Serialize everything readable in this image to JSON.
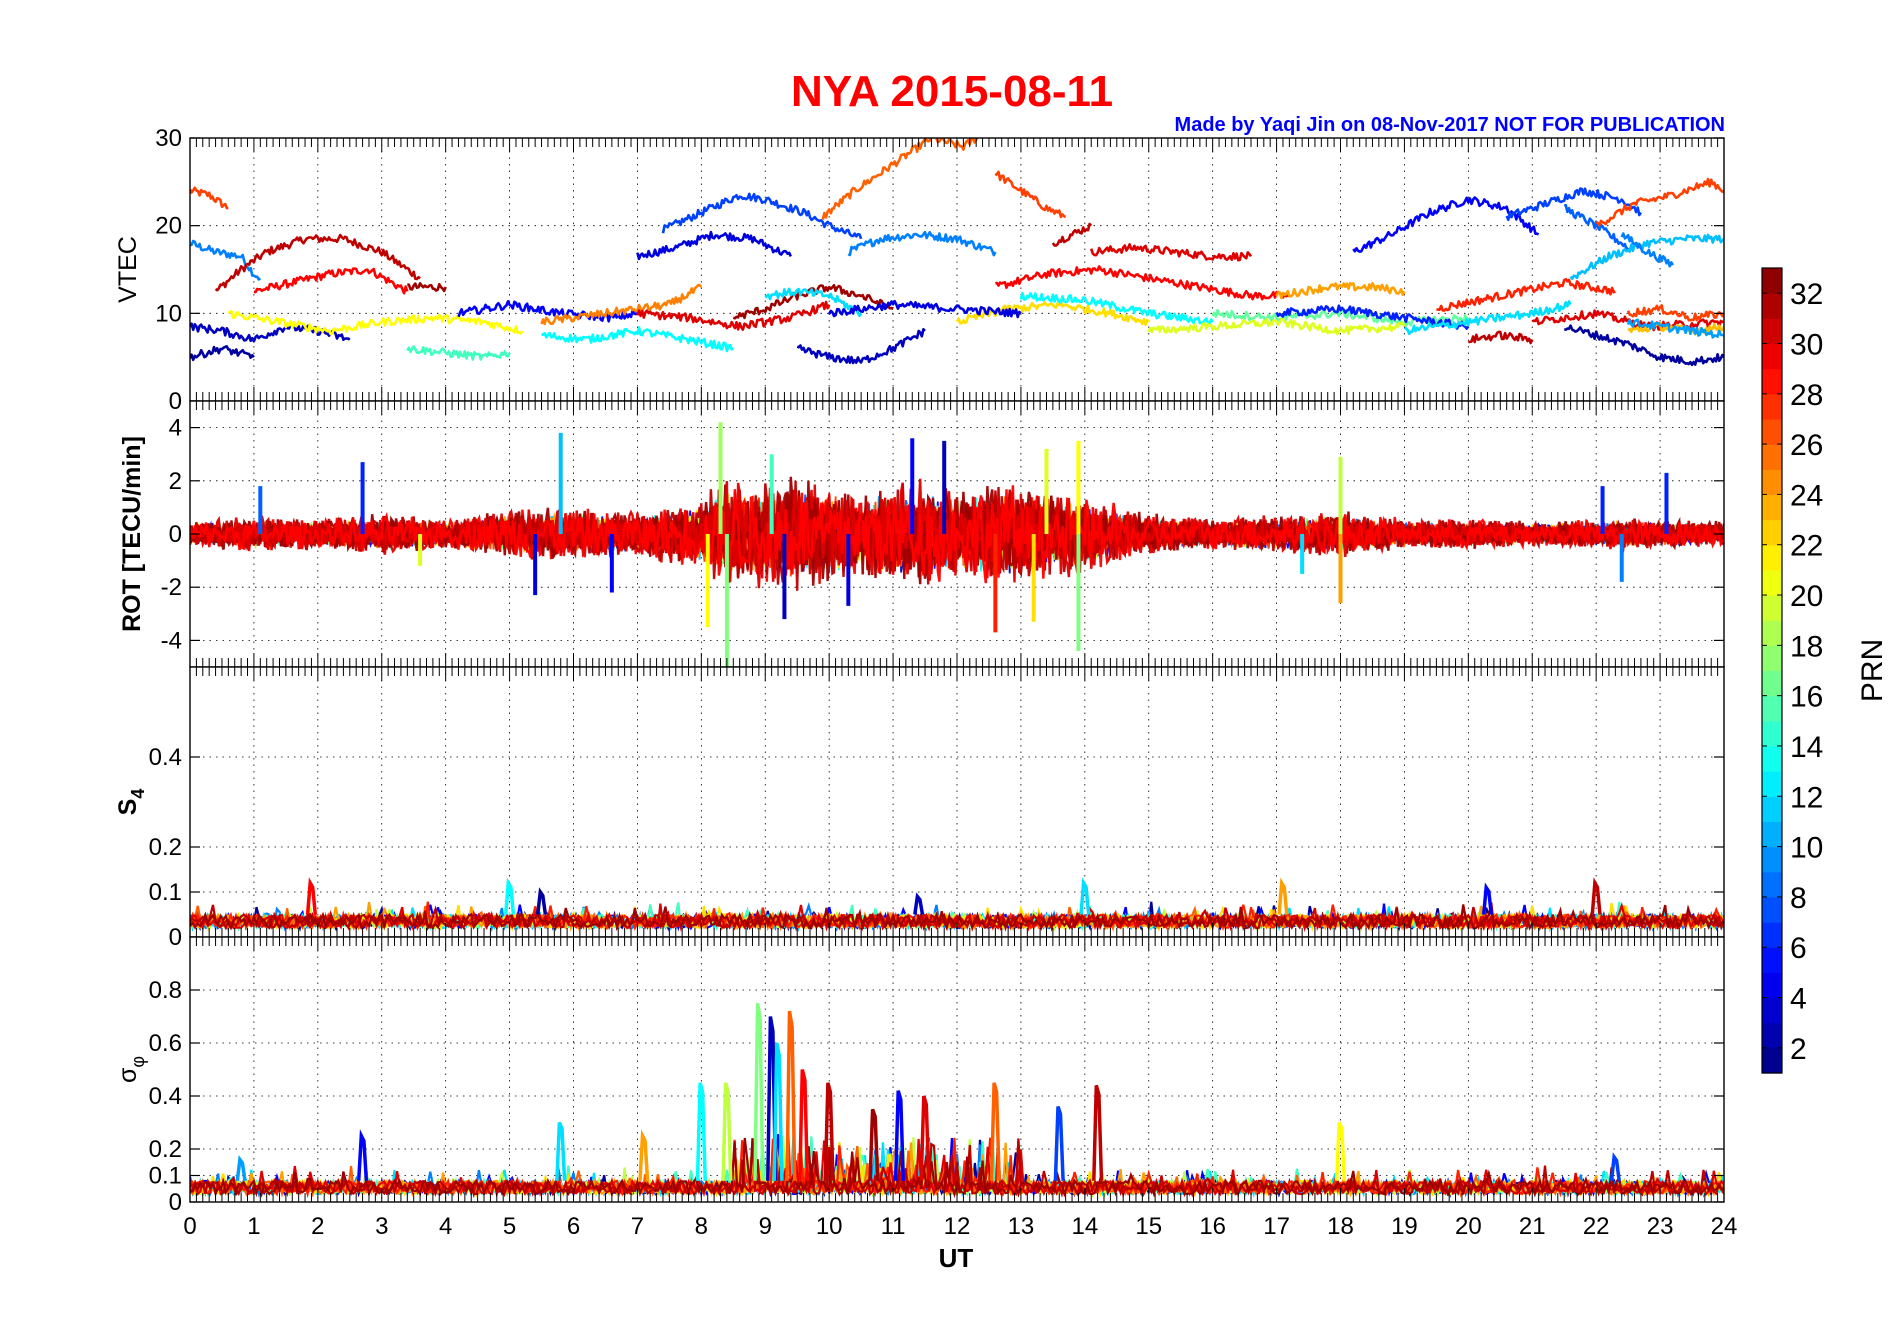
{
  "title": "NYA   2015-08-11",
  "credit": "Made by Yaqi Jin on 08-Nov-2017       NOT FOR PUBLICATION",
  "colors": {
    "title": "#ff0000",
    "credit": "#0000ff",
    "axis": "#000000",
    "grid": "#000000"
  },
  "chart_data": [
    {
      "type": "line",
      "panel": "vtec",
      "ylabel": "VTEC",
      "ylim": [
        0,
        30
      ],
      "yticks": [
        0,
        10,
        20,
        30
      ],
      "xlim": [
        0,
        24
      ],
      "grid": true,
      "series": [
        {
          "prn": 27,
          "x": [
            0,
            0.3,
            0.6
          ],
          "y": [
            24,
            23.5,
            22
          ]
        },
        {
          "prn": 9,
          "x": [
            0,
            0.4,
            0.8,
            1.0,
            1.1
          ],
          "y": [
            18,
            17,
            16.5,
            14.5,
            14
          ]
        },
        {
          "prn": 31,
          "x": [
            0.4,
            0.8,
            1.2,
            1.8,
            2.4,
            3.0,
            3.6
          ],
          "y": [
            12.5,
            15,
            17,
            18.5,
            18.5,
            17,
            14
          ]
        },
        {
          "prn": 29,
          "x": [
            1.0,
            1.6,
            2.2,
            2.8,
            3.4
          ],
          "y": [
            12.5,
            13.5,
            14.5,
            15,
            12.5
          ]
        },
        {
          "prn": 32,
          "x": [
            3.4,
            4.0
          ],
          "y": [
            13,
            13
          ]
        },
        {
          "prn": 7,
          "x": [
            7.4,
            8.0,
            8.6,
            9.0,
            9.6,
            10.0,
            10.5
          ],
          "y": [
            19.5,
            21.5,
            23.5,
            23,
            21.5,
            20,
            18.5
          ]
        },
        {
          "prn": 4,
          "x": [
            7.0,
            7.6,
            8.2,
            8.8,
            9.4
          ],
          "y": [
            16.5,
            17.5,
            19,
            18.5,
            16.5
          ]
        },
        {
          "prn": 26,
          "x": [
            9.9,
            10.4,
            11.0,
            11.6,
            12.1,
            12.5
          ],
          "y": [
            21,
            24,
            27,
            30,
            29,
            31
          ]
        },
        {
          "prn": 27,
          "x": [
            12.6,
            13.0,
            13.4,
            13.7
          ],
          "y": [
            26,
            24,
            22,
            21
          ]
        },
        {
          "prn": 9,
          "x": [
            10.3,
            10.8,
            11.4,
            12.0,
            12.6
          ],
          "y": [
            17,
            18.5,
            19,
            18.5,
            17
          ]
        },
        {
          "prn": 31,
          "x": [
            13.5,
            13.8,
            14.1
          ],
          "y": [
            18,
            19,
            20
          ]
        },
        {
          "prn": 30,
          "x": [
            14.1,
            14.8,
            15.4,
            16.0,
            16.6
          ],
          "y": [
            17,
            17.5,
            17,
            16.5,
            16.5
          ]
        },
        {
          "prn": 29,
          "x": [
            12.6,
            13.4,
            14.2,
            15.0,
            15.8,
            16.6,
            17.2
          ],
          "y": [
            13,
            14.5,
            15,
            14,
            13,
            12,
            12
          ]
        },
        {
          "prn": 5,
          "x": [
            18.2,
            18.8,
            19.4,
            20.0,
            20.6,
            21.1
          ],
          "y": [
            17,
            19,
            21.5,
            23,
            22,
            19
          ]
        },
        {
          "prn": 7,
          "x": [
            20.6,
            21.2,
            21.8,
            22.4,
            22.7
          ],
          "y": [
            21,
            22.5,
            24,
            23,
            21.5
          ]
        },
        {
          "prn": 8,
          "x": [
            21.5,
            22.0,
            22.5
          ],
          "y": [
            22,
            20,
            17.5
          ]
        },
        {
          "prn": 11,
          "x": [
            21.6,
            22.2,
            22.8,
            23.4,
            24.0
          ],
          "y": [
            14,
            16.5,
            18,
            18.5,
            18.5
          ]
        },
        {
          "prn": 27,
          "x": [
            22.0,
            22.6,
            23.2,
            23.8,
            24.0
          ],
          "y": [
            20,
            22.5,
            23.5,
            25,
            24
          ]
        },
        {
          "prn": 9,
          "x": [
            22.4,
            22.8,
            23.2
          ],
          "y": [
            19,
            17,
            15.5
          ]
        },
        {
          "prn": 28,
          "x": [
            19.5,
            20.5,
            21.5,
            22.3
          ],
          "y": [
            10.5,
            12,
            13.5,
            12.5
          ]
        },
        {
          "prn": 24,
          "x": [
            17.0,
            17.8,
            18.5,
            19.0
          ],
          "y": [
            12,
            13,
            13,
            12.5
          ]
        },
        {
          "prn": 3,
          "x": [
            0,
            0.5,
            1.0,
            1.5,
            2.0,
            2.5
          ],
          "y": [
            8.5,
            8,
            7,
            8.5,
            8,
            7
          ]
        },
        {
          "prn": 21,
          "x": [
            0.6,
            1.4,
            2.2,
            3.0,
            3.8,
            4.6,
            5.2
          ],
          "y": [
            10,
            9,
            8,
            9,
            9.5,
            9,
            8
          ]
        },
        {
          "prn": 15,
          "x": [
            3.4,
            4.0,
            4.6,
            5.0
          ],
          "y": [
            6,
            5.5,
            5,
            5.5
          ]
        },
        {
          "prn": 2,
          "x": [
            0,
            0.5,
            1.0
          ],
          "y": [
            5,
            6,
            5
          ]
        },
        {
          "prn": 5,
          "x": [
            4.2,
            5.0,
            5.8,
            6.6,
            7.0
          ],
          "y": [
            10,
            11,
            10,
            9.5,
            10
          ]
        },
        {
          "prn": 13,
          "x": [
            5.5,
            6.2,
            7.0,
            7.8,
            8.5
          ],
          "y": [
            7.5,
            7,
            8,
            7,
            6
          ]
        },
        {
          "prn": 25,
          "x": [
            5.5,
            6.5,
            7.5,
            8.0
          ],
          "y": [
            9,
            10,
            11,
            13
          ]
        },
        {
          "prn": 3,
          "x": [
            9.5,
            10.0,
            10.5,
            11.0,
            11.5
          ],
          "y": [
            6,
            5,
            4.5,
            6,
            8
          ]
        },
        {
          "prn": 32,
          "x": [
            8.5,
            9.0,
            9.5,
            10.0,
            10.5,
            11.0
          ],
          "y": [
            9.5,
            10.5,
            12,
            13,
            12,
            10.5
          ]
        },
        {
          "prn": 30,
          "x": [
            7.0,
            7.8,
            8.6,
            9.4,
            10.0
          ],
          "y": [
            10,
            9.5,
            8.5,
            9.5,
            11
          ]
        },
        {
          "prn": 22,
          "x": [
            12.0,
            12.8,
            13.6,
            14.4,
            15.0
          ],
          "y": [
            9,
            10.5,
            11,
            10,
            9
          ]
        },
        {
          "prn": 12,
          "x": [
            9.0,
            9.5,
            10.0,
            10.5
          ],
          "y": [
            12,
            12.5,
            12,
            10
          ]
        },
        {
          "prn": 4,
          "x": [
            10.0,
            11.0,
            12.0,
            13.0
          ],
          "y": [
            10,
            11,
            10.5,
            10
          ]
        },
        {
          "prn": 13,
          "x": [
            13.0,
            14.0,
            15.0,
            16.0
          ],
          "y": [
            12,
            11.5,
            10,
            9
          ]
        },
        {
          "prn": 16,
          "x": [
            16.0,
            17.0,
            18.0,
            19.0,
            20.0
          ],
          "y": [
            10,
            9.5,
            10,
            9,
            9.5
          ]
        },
        {
          "prn": 20,
          "x": [
            15.0,
            16.0,
            17.0,
            18.0,
            19.0
          ],
          "y": [
            8,
            8.5,
            9,
            8,
            8.5
          ]
        },
        {
          "prn": 6,
          "x": [
            17.0,
            18.0,
            19.0,
            20.0
          ],
          "y": [
            10,
            10.5,
            9.5,
            8.5
          ]
        },
        {
          "prn": 12,
          "x": [
            19.0,
            20.0,
            21.0,
            21.6
          ],
          "y": [
            8,
            9,
            10,
            11
          ]
        },
        {
          "prn": 31,
          "x": [
            20.0,
            20.5,
            21.0
          ],
          "y": [
            7,
            7.5,
            7
          ]
        },
        {
          "prn": 2,
          "x": [
            21.5,
            22.0,
            22.5,
            23.0,
            23.5,
            24.0
          ],
          "y": [
            8.5,
            7.5,
            6.5,
            5,
            4.5,
            5
          ]
        },
        {
          "prn": 30,
          "x": [
            21.0,
            22.0,
            22.8,
            24.0
          ],
          "y": [
            9,
            10,
            8.5,
            9
          ]
        },
        {
          "prn": 23,
          "x": [
            22.5,
            23.0,
            23.5,
            24.0
          ],
          "y": [
            8,
            8.5,
            8,
            8.5
          ]
        },
        {
          "prn": 10,
          "x": [
            22.5,
            23.0,
            23.5,
            24.0
          ],
          "y": [
            9,
            8.5,
            8,
            7.5
          ]
        },
        {
          "prn": 27,
          "x": [
            22.5,
            23.0,
            23.5,
            24.0
          ],
          "y": [
            10,
            10.5,
            9.5,
            10
          ]
        }
      ]
    },
    {
      "type": "line",
      "panel": "rot",
      "ylabel": "ROT [TECU/min]",
      "ylim": [
        -5,
        5
      ],
      "yticks": [
        -4,
        -2,
        0,
        2,
        4
      ],
      "xlim": [
        0,
        24
      ],
      "grid": true,
      "envelope": [
        [
          0,
          0.5
        ],
        [
          1,
          0.7
        ],
        [
          2,
          0.6
        ],
        [
          3,
          0.8
        ],
        [
          4,
          0.6
        ],
        [
          5,
          1.0
        ],
        [
          6,
          1.1
        ],
        [
          7,
          0.9
        ],
        [
          8,
          1.4
        ],
        [
          8.5,
          2.4
        ],
        [
          9,
          2.1
        ],
        [
          9.5,
          2.3
        ],
        [
          10,
          2.0
        ],
        [
          10.5,
          1.8
        ],
        [
          11,
          2.0
        ],
        [
          11.5,
          2.2
        ],
        [
          12,
          1.7
        ],
        [
          12.5,
          2.2
        ],
        [
          13,
          2.0
        ],
        [
          13.5,
          1.8
        ],
        [
          14,
          1.5
        ],
        [
          15,
          0.8
        ],
        [
          16,
          0.6
        ],
        [
          17,
          0.8
        ],
        [
          18,
          0.9
        ],
        [
          19,
          0.6
        ],
        [
          20,
          0.6
        ],
        [
          21,
          0.5
        ],
        [
          22,
          0.6
        ],
        [
          23,
          0.6
        ],
        [
          24,
          0.5
        ]
      ],
      "spikes": [
        {
          "x": 1.1,
          "y": 1.8,
          "prn": 8
        },
        {
          "x": 2.7,
          "y": 2.7,
          "prn": 6
        },
        {
          "x": 3.6,
          "y": -1.2,
          "prn": 20
        },
        {
          "x": 5.4,
          "y": -2.3,
          "prn": 4
        },
        {
          "x": 5.8,
          "y": 3.8,
          "prn": 11
        },
        {
          "x": 6.6,
          "y": -2.2,
          "prn": 5
        },
        {
          "x": 8.3,
          "y": 4.2,
          "prn": 18
        },
        {
          "x": 8.4,
          "y": -5.0,
          "prn": 17
        },
        {
          "x": 8.1,
          "y": -3.5,
          "prn": 21
        },
        {
          "x": 9.1,
          "y": 3.0,
          "prn": 15
        },
        {
          "x": 9.3,
          "y": -3.2,
          "prn": 3
        },
        {
          "x": 10.3,
          "y": -2.7,
          "prn": 4
        },
        {
          "x": 11.3,
          "y": 3.6,
          "prn": 5
        },
        {
          "x": 11.8,
          "y": 3.5,
          "prn": 3
        },
        {
          "x": 12.6,
          "y": -3.7,
          "prn": 28
        },
        {
          "x": 13.2,
          "y": -3.3,
          "prn": 22
        },
        {
          "x": 13.4,
          "y": 3.2,
          "prn": 20
        },
        {
          "x": 13.9,
          "y": 3.5,
          "prn": 21
        },
        {
          "x": 13.9,
          "y": -4.4,
          "prn": 17
        },
        {
          "x": 17.4,
          "y": -1.5,
          "prn": 12
        },
        {
          "x": 18.0,
          "y": 2.9,
          "prn": 19
        },
        {
          "x": 18.0,
          "y": -2.6,
          "prn": 24
        },
        {
          "x": 22.1,
          "y": 1.8,
          "prn": 6
        },
        {
          "x": 22.4,
          "y": -1.8,
          "prn": 9
        },
        {
          "x": 23.1,
          "y": 2.3,
          "prn": 6
        }
      ]
    },
    {
      "type": "line",
      "panel": "s4",
      "ylabel": "S",
      "ylabel_sub": "4",
      "ylim": [
        0,
        0.6
      ],
      "yticks": [
        0,
        0.1,
        0.2,
        0.4
      ],
      "xlim": [
        0,
        24
      ],
      "grid": true,
      "baseline": [
        0.02,
        0.05
      ],
      "spikes": [
        {
          "x": 1.9,
          "y": 0.12,
          "prn": 29
        },
        {
          "x": 5.0,
          "y": 0.12,
          "prn": 13
        },
        {
          "x": 5.5,
          "y": 0.1,
          "prn": 2
        },
        {
          "x": 11.4,
          "y": 0.09,
          "prn": 3
        },
        {
          "x": 14.0,
          "y": 0.12,
          "prn": 12
        },
        {
          "x": 17.1,
          "y": 0.12,
          "prn": 24
        },
        {
          "x": 20.3,
          "y": 0.11,
          "prn": 5
        },
        {
          "x": 22.0,
          "y": 0.12,
          "prn": 31
        }
      ]
    },
    {
      "type": "line",
      "panel": "sigma_phi",
      "ylabel": "σ",
      "ylabel_sub": "φ",
      "ylim": [
        0,
        1.0
      ],
      "yticks": [
        0,
        0.1,
        0.2,
        0.4,
        0.6,
        0.8
      ],
      "xlim": [
        0,
        24
      ],
      "xticks": [
        0,
        1,
        2,
        3,
        4,
        5,
        6,
        7,
        8,
        9,
        10,
        11,
        12,
        13,
        14,
        15,
        16,
        17,
        18,
        19,
        20,
        21,
        22,
        23,
        24
      ],
      "xlabel": "UT",
      "grid": true,
      "baseline": [
        0.03,
        0.08
      ],
      "spikes": [
        {
          "x": 0.8,
          "y": 0.16,
          "prn": 10
        },
        {
          "x": 2.7,
          "y": 0.25,
          "prn": 5
        },
        {
          "x": 5.8,
          "y": 0.3,
          "prn": 12
        },
        {
          "x": 7.1,
          "y": 0.25,
          "prn": 24
        },
        {
          "x": 8.0,
          "y": 0.45,
          "prn": 13
        },
        {
          "x": 8.4,
          "y": 0.45,
          "prn": 19
        },
        {
          "x": 8.9,
          "y": 0.75,
          "prn": 17
        },
        {
          "x": 9.1,
          "y": 0.7,
          "prn": 3
        },
        {
          "x": 9.2,
          "y": 0.6,
          "prn": 12
        },
        {
          "x": 9.4,
          "y": 0.72,
          "prn": 26
        },
        {
          "x": 9.6,
          "y": 0.5,
          "prn": 29
        },
        {
          "x": 10.0,
          "y": 0.45,
          "prn": 31
        },
        {
          "x": 10.7,
          "y": 0.35,
          "prn": 32
        },
        {
          "x": 11.1,
          "y": 0.42,
          "prn": 5
        },
        {
          "x": 11.5,
          "y": 0.4,
          "prn": 30
        },
        {
          "x": 12.6,
          "y": 0.45,
          "prn": 26
        },
        {
          "x": 13.6,
          "y": 0.36,
          "prn": 7
        },
        {
          "x": 14.2,
          "y": 0.44,
          "prn": 31
        },
        {
          "x": 18.0,
          "y": 0.3,
          "prn": 21
        },
        {
          "x": 22.3,
          "y": 0.17,
          "prn": 7
        }
      ]
    }
  ],
  "colorbar": {
    "label": "PRN",
    "range": [
      1,
      33
    ],
    "ticks": [
      2,
      4,
      6,
      8,
      10,
      12,
      14,
      16,
      18,
      20,
      22,
      24,
      26,
      28,
      30,
      32
    ],
    "colormap": "jet"
  }
}
